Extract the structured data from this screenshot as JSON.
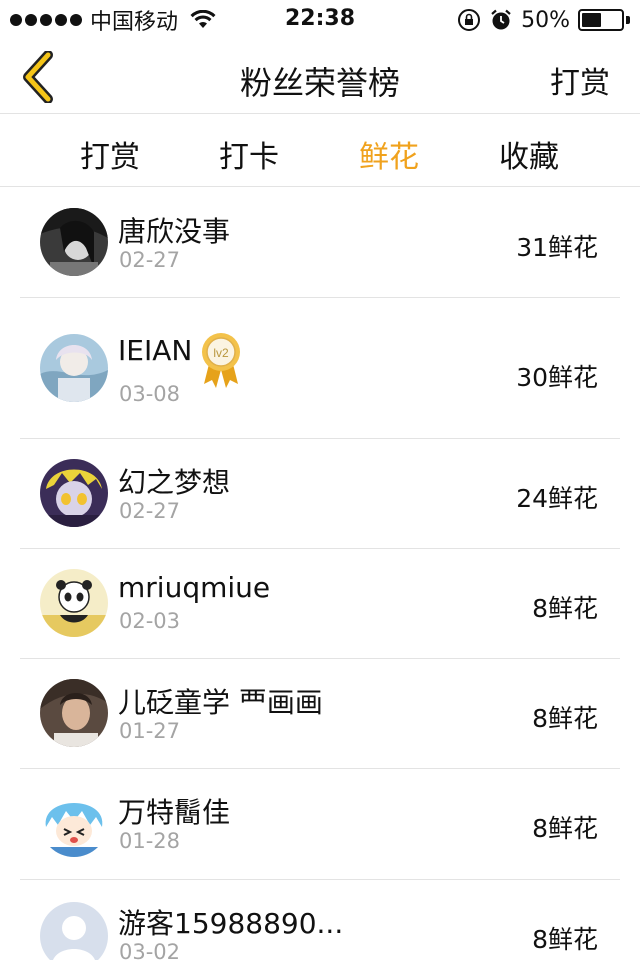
{
  "status_bar": {
    "carrier": "中国移动",
    "time": "22:38",
    "battery_text": "50%",
    "battery_level": 0.5
  },
  "navbar": {
    "back_icon": "chevron-left-icon",
    "title": "粉丝荣誉榜",
    "action_label": "打赏"
  },
  "tabs": [
    {
      "label": "打赏",
      "active": false
    },
    {
      "label": "打卡",
      "active": false
    },
    {
      "label": "鲜花",
      "active": true
    },
    {
      "label": "收藏",
      "active": false
    }
  ],
  "colors": {
    "accent": "#f0a21d",
    "back_icon": "#f5c518",
    "divider": "#e3e3e3",
    "secondary_text": "#a4a4a4"
  },
  "list": [
    {
      "name": "唐欣没事",
      "date": "02-27",
      "count": "31鲜花",
      "badge": null
    },
    {
      "name": "IEIAN",
      "date": "03-08",
      "count": "30鲜花",
      "badge": "lv2"
    },
    {
      "name": "幻之梦想",
      "date": "02-27",
      "count": "24鲜花",
      "badge": null
    },
    {
      "name": "mriuqmiue",
      "date": "02-03",
      "count": "8鲜花",
      "badge": null
    },
    {
      "name": "儿砭童学 ⻃画画",
      "date": "01-27",
      "count": "8鲜花",
      "badge": null
    },
    {
      "name": "万特鬝佳",
      "date": "01-28",
      "count": "8鲜花",
      "badge": null
    },
    {
      "name": "游客15988890...",
      "date": "03-02",
      "count": "8鲜花",
      "badge": null
    }
  ]
}
